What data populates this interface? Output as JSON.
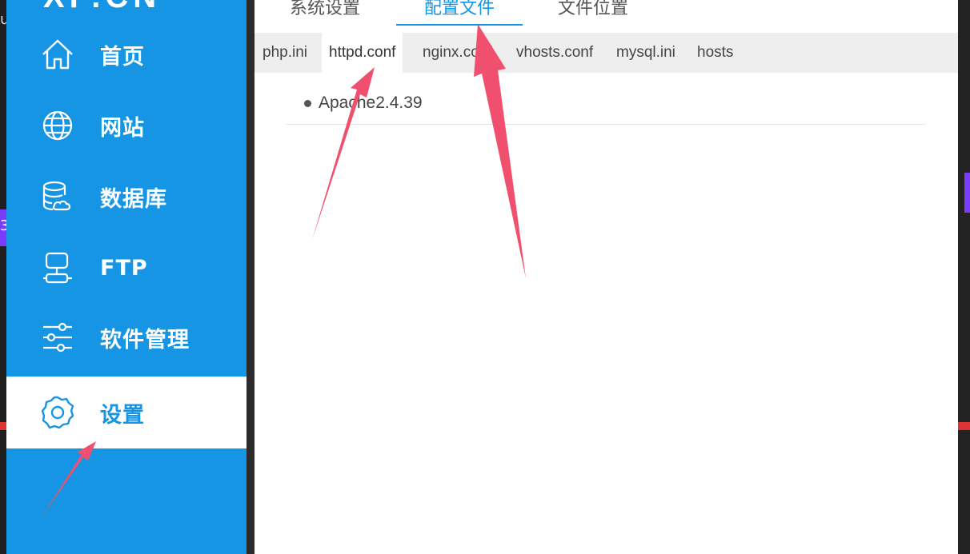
{
  "app": {
    "logo_text": "XP.CN"
  },
  "background": {
    "left_snippets": [
      "u",
      "",
      "3"
    ]
  },
  "sidebar": {
    "items": [
      {
        "label": "首页",
        "icon": "home-icon",
        "active": false
      },
      {
        "label": "网站",
        "icon": "globe-icon",
        "active": false
      },
      {
        "label": "数据库",
        "icon": "database-icon",
        "active": false
      },
      {
        "label": "FTP",
        "icon": "ftp-server-icon",
        "active": false
      },
      {
        "label": "软件管理",
        "icon": "sliders-icon",
        "active": false
      },
      {
        "label": "设置",
        "icon": "gear-icon",
        "active": true
      }
    ]
  },
  "main": {
    "top_tabs": [
      {
        "label": "系统设置",
        "active": false
      },
      {
        "label": "配置文件",
        "active": true
      },
      {
        "label": "文件位置",
        "active": false
      }
    ],
    "sub_tabs": [
      {
        "label": "php.ini",
        "active": false
      },
      {
        "label": "httpd.conf",
        "active": true
      },
      {
        "label": "nginx.conf",
        "active": false
      },
      {
        "label": "vhosts.conf",
        "active": false
      },
      {
        "label": "mysql.ini",
        "active": false
      },
      {
        "label": "hosts",
        "active": false
      }
    ],
    "items": [
      {
        "label": "Apache2.4.39"
      }
    ]
  },
  "colors": {
    "accent": "#1695e4",
    "arrow": "#f0506e",
    "tab_bar": "#eeeeee"
  }
}
